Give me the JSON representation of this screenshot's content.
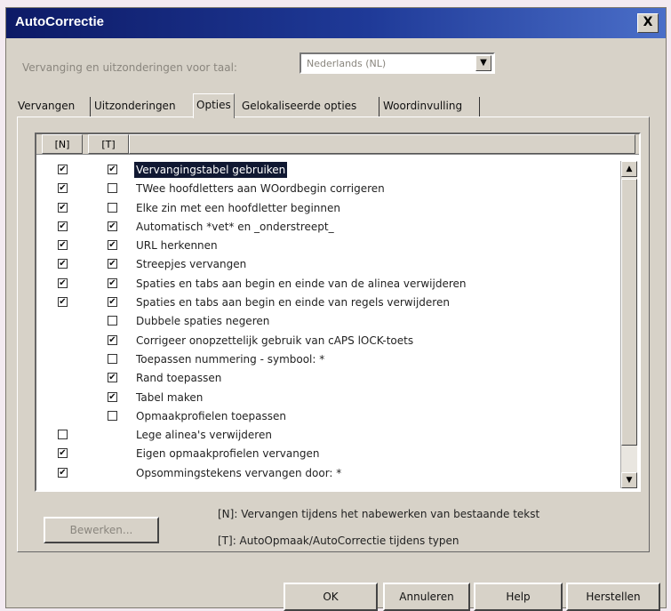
{
  "window": {
    "title": "AutoCorrectie",
    "close_label": "X"
  },
  "language": {
    "label": "Vervanging en uitzonderingen voor taal:",
    "value": "Nederlands (NL)"
  },
  "tabs": [
    {
      "label": "Vervangen",
      "active": false
    },
    {
      "label": "Uitzonderingen",
      "active": false
    },
    {
      "label": "Opties",
      "active": true
    },
    {
      "label": "Gelokaliseerde opties",
      "active": false
    },
    {
      "label": "Woordinvulling",
      "active": false
    }
  ],
  "list": {
    "headers": {
      "n": "[N]",
      "t": "[T]"
    },
    "items": [
      {
        "label": "Vervangingstabel gebruiken",
        "n": true,
        "t": true,
        "selected": true
      },
      {
        "label": "TWee hoofdletters aan WOordbegin corrigeren",
        "n": true,
        "t": false
      },
      {
        "label": "Elke zin met een hoofdletter beginnen",
        "n": true,
        "t": false
      },
      {
        "label": "Automatisch *vet* en _onderstreept_",
        "n": true,
        "t": true
      },
      {
        "label": "URL herkennen",
        "n": true,
        "t": true
      },
      {
        "label": "Streepjes vervangen",
        "n": true,
        "t": true
      },
      {
        "label": "Spaties en tabs aan begin en einde van de alinea verwijderen",
        "n": true,
        "t": true
      },
      {
        "label": "Spaties en tabs aan begin en einde van regels verwijderen",
        "n": true,
        "t": true
      },
      {
        "label": "Dubbele spaties negeren",
        "n": null,
        "t": false
      },
      {
        "label": "Corrigeer onopzettelijk gebruik van cAPS lOCK-toets",
        "n": null,
        "t": true
      },
      {
        "label": "Toepassen nummering - symbool: *",
        "n": null,
        "t": false
      },
      {
        "label": "Rand toepassen",
        "n": null,
        "t": true
      },
      {
        "label": "Tabel maken",
        "n": null,
        "t": true
      },
      {
        "label": "Opmaakprofielen toepassen",
        "n": null,
        "t": false
      },
      {
        "label": "Lege alinea's verwijderen",
        "n": false,
        "t": null
      },
      {
        "label": "Eigen opmaakprofielen vervangen",
        "n": true,
        "t": null
      },
      {
        "label": "Opsommingstekens vervangen door: *",
        "n": true,
        "t": null
      }
    ]
  },
  "edit_button": "Bewerken...",
  "notes": {
    "n": "[N]: Vervangen tijdens het nabewerken van bestaande tekst",
    "t": "[T]: AutoOpmaak/AutoCorrectie tijdens typen"
  },
  "buttons": {
    "ok": "OK",
    "cancel": "Annuleren",
    "help": "Help",
    "reset": "Herstellen"
  },
  "check_mark": "✔"
}
